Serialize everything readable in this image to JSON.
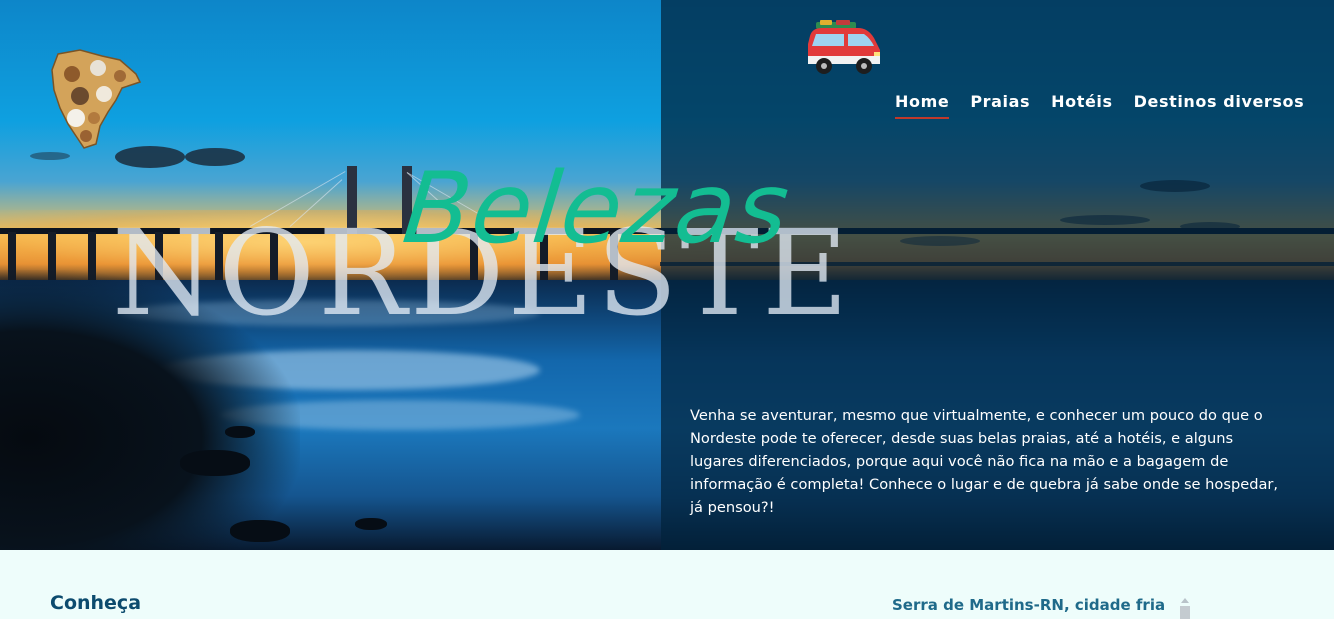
{
  "nav": {
    "items": [
      {
        "label": "Home",
        "active": true
      },
      {
        "label": "Praias",
        "active": false
      },
      {
        "label": "Hotéis",
        "active": false
      },
      {
        "label": "Destinos diversos",
        "active": false
      }
    ]
  },
  "hero": {
    "title_back": "NORDESTE",
    "title_front": "Belezas",
    "intro": "Venha se aventurar, mesmo que virtualmente, e conhecer um pouco do que o Nordeste pode te oferecer, desde suas belas praias, até a hotéis, e alguns lugares diferenciados, porque aqui você não fica na mão e a bagagem de informação é completa! Conhece o lugar e de quebra já sabe onde se hospedar, já pensou?!"
  },
  "section": {
    "heading": "Conheça",
    "side_link": "Serra de Martins-RN, cidade fria"
  },
  "icons": {
    "logo": "nordeste-map-logo-icon",
    "van": "travel-van-icon"
  },
  "colors": {
    "accent_green": "#13bd92",
    "nav_underline": "#c0392b",
    "heading_blue": "#0c4b6e",
    "section_bg": "#eefdfb"
  }
}
